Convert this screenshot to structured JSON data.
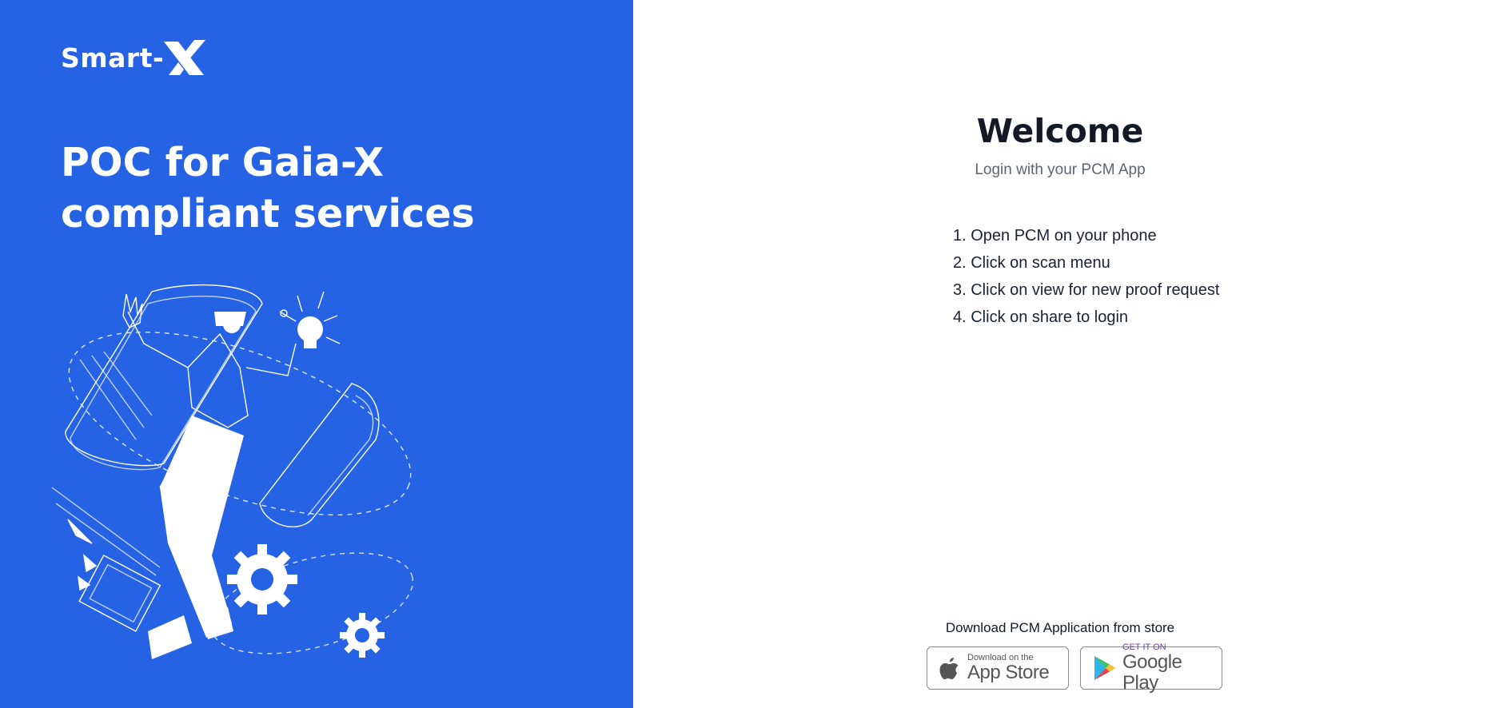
{
  "brand": {
    "name": "Smart-",
    "name_mark": "X"
  },
  "hero": {
    "title": "POC for Gaia-X compliant services"
  },
  "login": {
    "title": "Welcome",
    "subtitle": "Login with your PCM App",
    "steps": [
      "1. Open PCM on your phone",
      "2. Click on scan menu",
      "3. Click on view for new proof request",
      "4. Click on share to login"
    ]
  },
  "store": {
    "caption": "Download PCM Application from store",
    "app_store": {
      "small": "Download on the",
      "big": "App Store",
      "icon": "apple-icon"
    },
    "google_play": {
      "small": "GET IT ON",
      "big": "Google Play",
      "icon": "google-play-icon"
    }
  },
  "colors": {
    "brand_blue": "#2563e4",
    "text_dark": "#131a25",
    "text_muted": "#5e6470"
  }
}
